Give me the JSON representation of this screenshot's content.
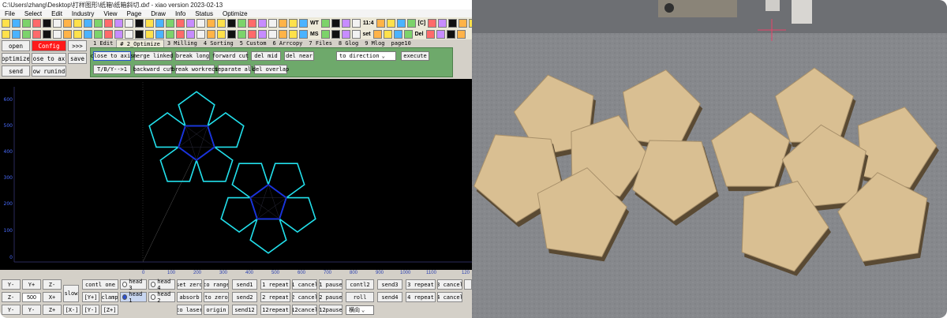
{
  "window": {
    "title": "C:\\Users\\zhang\\Desktop\\打样图形\\纸箱\\纸箱斜切.dxf - xiao version 2023-02-13"
  },
  "menu": [
    "File",
    "Select",
    "Edit",
    "Industry",
    "View",
    "Page",
    "Draw",
    "Info",
    "Status",
    "Optimize"
  ],
  "toolbar": {
    "row1_labels": [
      "WT",
      "11:4",
      "[C]"
    ],
    "row2_labels": [
      "MS",
      "set",
      "Del",
      "Del"
    ]
  },
  "left": {
    "open": "open",
    "config": "Config",
    "arrows": ">>>",
    "optimize": "optimize",
    "close_to_axis": "close to axis",
    "save": "save",
    "send": "send",
    "show_runindex": "show runindex"
  },
  "tabs": [
    "1 Edit",
    "# 2_Optimize",
    "3 Milling",
    "4 Sorting",
    "5 Custom",
    "6 Arrcopy",
    "7 Files",
    "8 Glog",
    "9 Mlog",
    "page10"
  ],
  "optimize_panel": {
    "row1": [
      "close to axis",
      "merge linked",
      "break long",
      "forward cut",
      "del mid",
      "del near"
    ],
    "direction": "to direction",
    "execute": "execute",
    "row2": [
      "T/B/Y-->1",
      "backward cut",
      "break workrect",
      "separate all",
      "del overlap"
    ]
  },
  "axes": {
    "y_ticks": [
      "600",
      "500",
      "400",
      "300",
      "200",
      "100",
      "0"
    ],
    "x_ticks": [
      "0",
      "100",
      "200",
      "300",
      "400",
      "500",
      "600",
      "700",
      "800",
      "900",
      "1000",
      "1100",
      "120"
    ]
  },
  "bottom": {
    "row1": {
      "y_minus": "Y-",
      "y_plus": "Y+",
      "z_minus": "Z-",
      "slow": "slow",
      "contl_one": "contl one",
      "head3": "head 3",
      "head4": "head 4",
      "set_zero": "set zero",
      "to_range": "to range",
      "send1": "send1",
      "repeat1": "1 repeat",
      "cancel1": "1 cancel",
      "pause1": "1 pause",
      "contl2": "contl2",
      "send3": "send3",
      "repeat3": "3 repeat",
      "cancel3": "3 cancel"
    },
    "row2": {
      "z_minus": "Z-",
      "step": "500",
      "x_plus": "X+",
      "y_plus_b": "[Y+]",
      "clamp": "clamp",
      "head1": "head 1",
      "head2": "head 2",
      "absorb": "absorb",
      "to_zero": "to zero",
      "send2": "send2",
      "repeat2": "2 repeat",
      "cancel2": "2 cancel",
      "pause2": "2 pause",
      "roll": "roll",
      "send4": "send4",
      "repeat4": "4 repeat",
      "cancel4": "4 cancel"
    },
    "row3": {
      "y_minus": "Y-",
      "y_minus2": "Y-",
      "z_plus": "Z+",
      "x_minus_b": "[X-]",
      "y_minus_b": "[Y-]",
      "z_plus_b": "[Z+]",
      "to_laser": "to laser",
      "origin": "origin",
      "send12": "send12",
      "repeat12": "12repeat",
      "cancel12": "12cancel",
      "pause12": "12pause",
      "dir_select": "横向"
    }
  },
  "colors": {
    "outer": "#22e0ec",
    "inner": "#1a2fe0",
    "panel_green": "#6ea96b",
    "config_red": "#ff1a1a"
  }
}
